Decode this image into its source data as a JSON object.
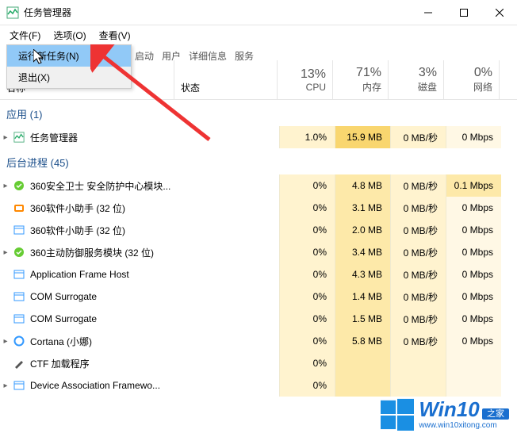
{
  "titlebar": {
    "title": "任务管理器"
  },
  "menubar": {
    "file": "文件(F)",
    "options": "选项(O)",
    "view": "查看(V)"
  },
  "dropdown": {
    "run": "运行新任务(N)",
    "exit": "退出(X)"
  },
  "tabs_hidden": {
    "startup": "启动",
    "users": "用户",
    "details": "详细信息",
    "services": "服务"
  },
  "columns": {
    "name": "名称",
    "status": "状态",
    "cpu_pct": "13%",
    "cpu_lbl": "CPU",
    "mem_pct": "71%",
    "mem_lbl": "内存",
    "disk_pct": "3%",
    "disk_lbl": "磁盘",
    "net_pct": "0%",
    "net_lbl": "网络"
  },
  "groups": {
    "apps": {
      "label": "应用 (1)"
    },
    "bg": {
      "label": "后台进程 (45)"
    }
  },
  "rows": {
    "r0": {
      "name": "任务管理器",
      "cpu": "1.0%",
      "mem": "15.9 MB",
      "disk": "0 MB/秒",
      "net": "0 Mbps"
    },
    "r1": {
      "name": "360安全卫士 安全防护中心模块...",
      "cpu": "0%",
      "mem": "4.8 MB",
      "disk": "0 MB/秒",
      "net": "0.1 Mbps"
    },
    "r2": {
      "name": "360软件小助手 (32 位)",
      "cpu": "0%",
      "mem": "3.1 MB",
      "disk": "0 MB/秒",
      "net": "0 Mbps"
    },
    "r3": {
      "name": "360软件小助手 (32 位)",
      "cpu": "0%",
      "mem": "2.0 MB",
      "disk": "0 MB/秒",
      "net": "0 Mbps"
    },
    "r4": {
      "name": "360主动防御服务模块 (32 位)",
      "cpu": "0%",
      "mem": "3.4 MB",
      "disk": "0 MB/秒",
      "net": "0 Mbps"
    },
    "r5": {
      "name": "Application Frame Host",
      "cpu": "0%",
      "mem": "4.3 MB",
      "disk": "0 MB/秒",
      "net": "0 Mbps"
    },
    "r6": {
      "name": "COM Surrogate",
      "cpu": "0%",
      "mem": "1.4 MB",
      "disk": "0 MB/秒",
      "net": "0 Mbps"
    },
    "r7": {
      "name": "COM Surrogate",
      "cpu": "0%",
      "mem": "1.5 MB",
      "disk": "0 MB/秒",
      "net": "0 Mbps"
    },
    "r8": {
      "name": "Cortana (小娜)",
      "cpu": "0%",
      "mem": "5.8 MB",
      "disk": "0 MB/秒",
      "net": "0 Mbps"
    },
    "r9": {
      "name": "CTF 加载程序",
      "cpu": "0%",
      "mem": "",
      "disk": "",
      "net": ""
    },
    "r10": {
      "name": "Device Association Framewo...",
      "cpu": "0%",
      "mem": "",
      "disk": "",
      "net": ""
    }
  },
  "watermark": {
    "main": "Win10",
    "sub": "之家",
    "url": "www.win10xitong.com"
  },
  "icons": {
    "taskmgr": "task-manager-icon",
    "shield_green": "shield-green-icon",
    "box_orange": "box-orange-icon",
    "window_blue": "window-blue-icon",
    "cortana": "cortana-icon",
    "pen": "pen-icon",
    "generic": "app-icon"
  }
}
